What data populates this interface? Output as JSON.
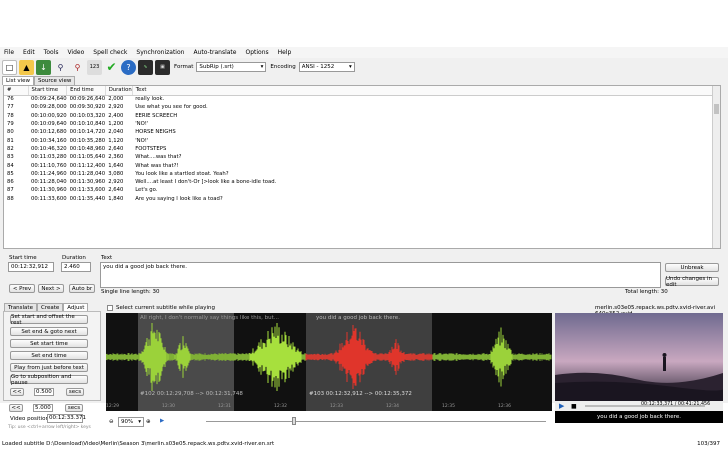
{
  "menu": [
    "File",
    "Edit",
    "Tools",
    "Video",
    "Spell check",
    "Synchronization",
    "Auto-translate",
    "Options",
    "Help"
  ],
  "toolbar": {
    "format_label": "Format",
    "format_value": "SubRip (.srt)",
    "encoding_label": "Encoding",
    "encoding_value": "ANSI - 1252"
  },
  "view_tabs": [
    "List view",
    "Source view"
  ],
  "grid": {
    "headers": [
      "#",
      "Start time",
      "End time",
      "Duration",
      "Text"
    ],
    "rows": [
      [
        "76",
        "00:09:24,640",
        "00:09:26,640",
        "2,000",
        "really look."
      ],
      [
        "77",
        "00:09:28,000",
        "00:09:30,920",
        "2,920",
        "Use what you see for good."
      ],
      [
        "78",
        "00:10:00,920",
        "00:10:03,320",
        "2,400",
        "EERIE SCREECH"
      ],
      [
        "79",
        "00:10:09,640",
        "00:10:10,840",
        "1,200",
        "'NO!'"
      ],
      [
        "80",
        "00:10:12,680",
        "00:10:14,720",
        "2,040",
        "HORSE NEIGHS"
      ],
      [
        "81",
        "00:10:34,160",
        "00:10:35,280",
        "1,120",
        "'NO!'"
      ],
      [
        "82",
        "00:10:46,320",
        "00:10:48,960",
        "2,640",
        "FOOTSTEPS"
      ],
      [
        "83",
        "00:11:03,280",
        "00:11:05,640",
        "2,360",
        "What....was that?"
      ],
      [
        "84",
        "00:11:10,760",
        "00:11:12,400",
        "1,640",
        "What was that?!"
      ],
      [
        "85",
        "00:11:24,960",
        "00:11:28,040",
        "3,080",
        "You look like a startled stoat. Yeah?"
      ],
      [
        "86",
        "00:11:28,040",
        "00:11:30,960",
        "2,920",
        "Well....at least I don't-Or ]>look like a bone-idle toad."
      ],
      [
        "87",
        "00:11:30,960",
        "00:11:33,600",
        "2,640",
        "Let's go."
      ],
      [
        "88",
        "00:11:33,600",
        "00:11:35,440",
        "1,840",
        "Are you saying I look like a toad?"
      ]
    ]
  },
  "editor": {
    "start_label": "Start time",
    "start_value": "00:12:32,912",
    "duration_label": "Duration",
    "duration_value": "2.460",
    "text_label": "Text",
    "text_value": "you did a good job back there.",
    "prev": "< Prev",
    "next": "Next >",
    "autobr": "Auto br",
    "single_line": "Single line length: 30",
    "total_length": "Total length: 30",
    "unbreak": "Unbreak",
    "undo": "Undo changes in edit"
  },
  "lower_tabs": [
    "Translate",
    "Create",
    "Adjust"
  ],
  "adjust": {
    "buttons": [
      "Set start and offset the rest",
      "Set end & goto next",
      "Set start time",
      "Set end time",
      "Play from just before text",
      "Go to subposition and pause"
    ],
    "step1_label": "<<",
    "step1_value": "0.500",
    "step1_unit": "secs",
    "step2_label": "<<",
    "step2_value": "5.000",
    "step2_unit": "secs",
    "video_position_label": "Video position:",
    "video_position_value": "00:12:33.371",
    "tip": "Tip: use <ctrl+arrow left/right> keys"
  },
  "waveform": {
    "checkbox_label": "Select current subtitle while playing",
    "faint_text": "All right, I don't normally say things like this, but...",
    "seg1": "#102  00:12:29,708 --> 00:12:31,748",
    "seg2": "#103  00:12:32,912 --> 00:12:35,372",
    "seg2_text": "you did a good job back there.",
    "ticks": [
      "12:29",
      "12:30",
      "12:31",
      "12:32",
      "12:33",
      "12:34",
      "12:35",
      "12:36"
    ],
    "zoom_value": "90%"
  },
  "video": {
    "file_info": "merlin.s03e05.repack.ws.pdtv.xvid-river.avi 640x352 xvid",
    "time": "00:12:33,371 / 00:41:21,456",
    "subtitle": "you did a good job back there."
  },
  "status": {
    "left": "Loaded subtitle D:\\Download\\Video\\Merlin\\Season 3\\merlin.s03e05.repack.ws.pdtv.xvid-river.en.srt",
    "right": "103/397"
  }
}
